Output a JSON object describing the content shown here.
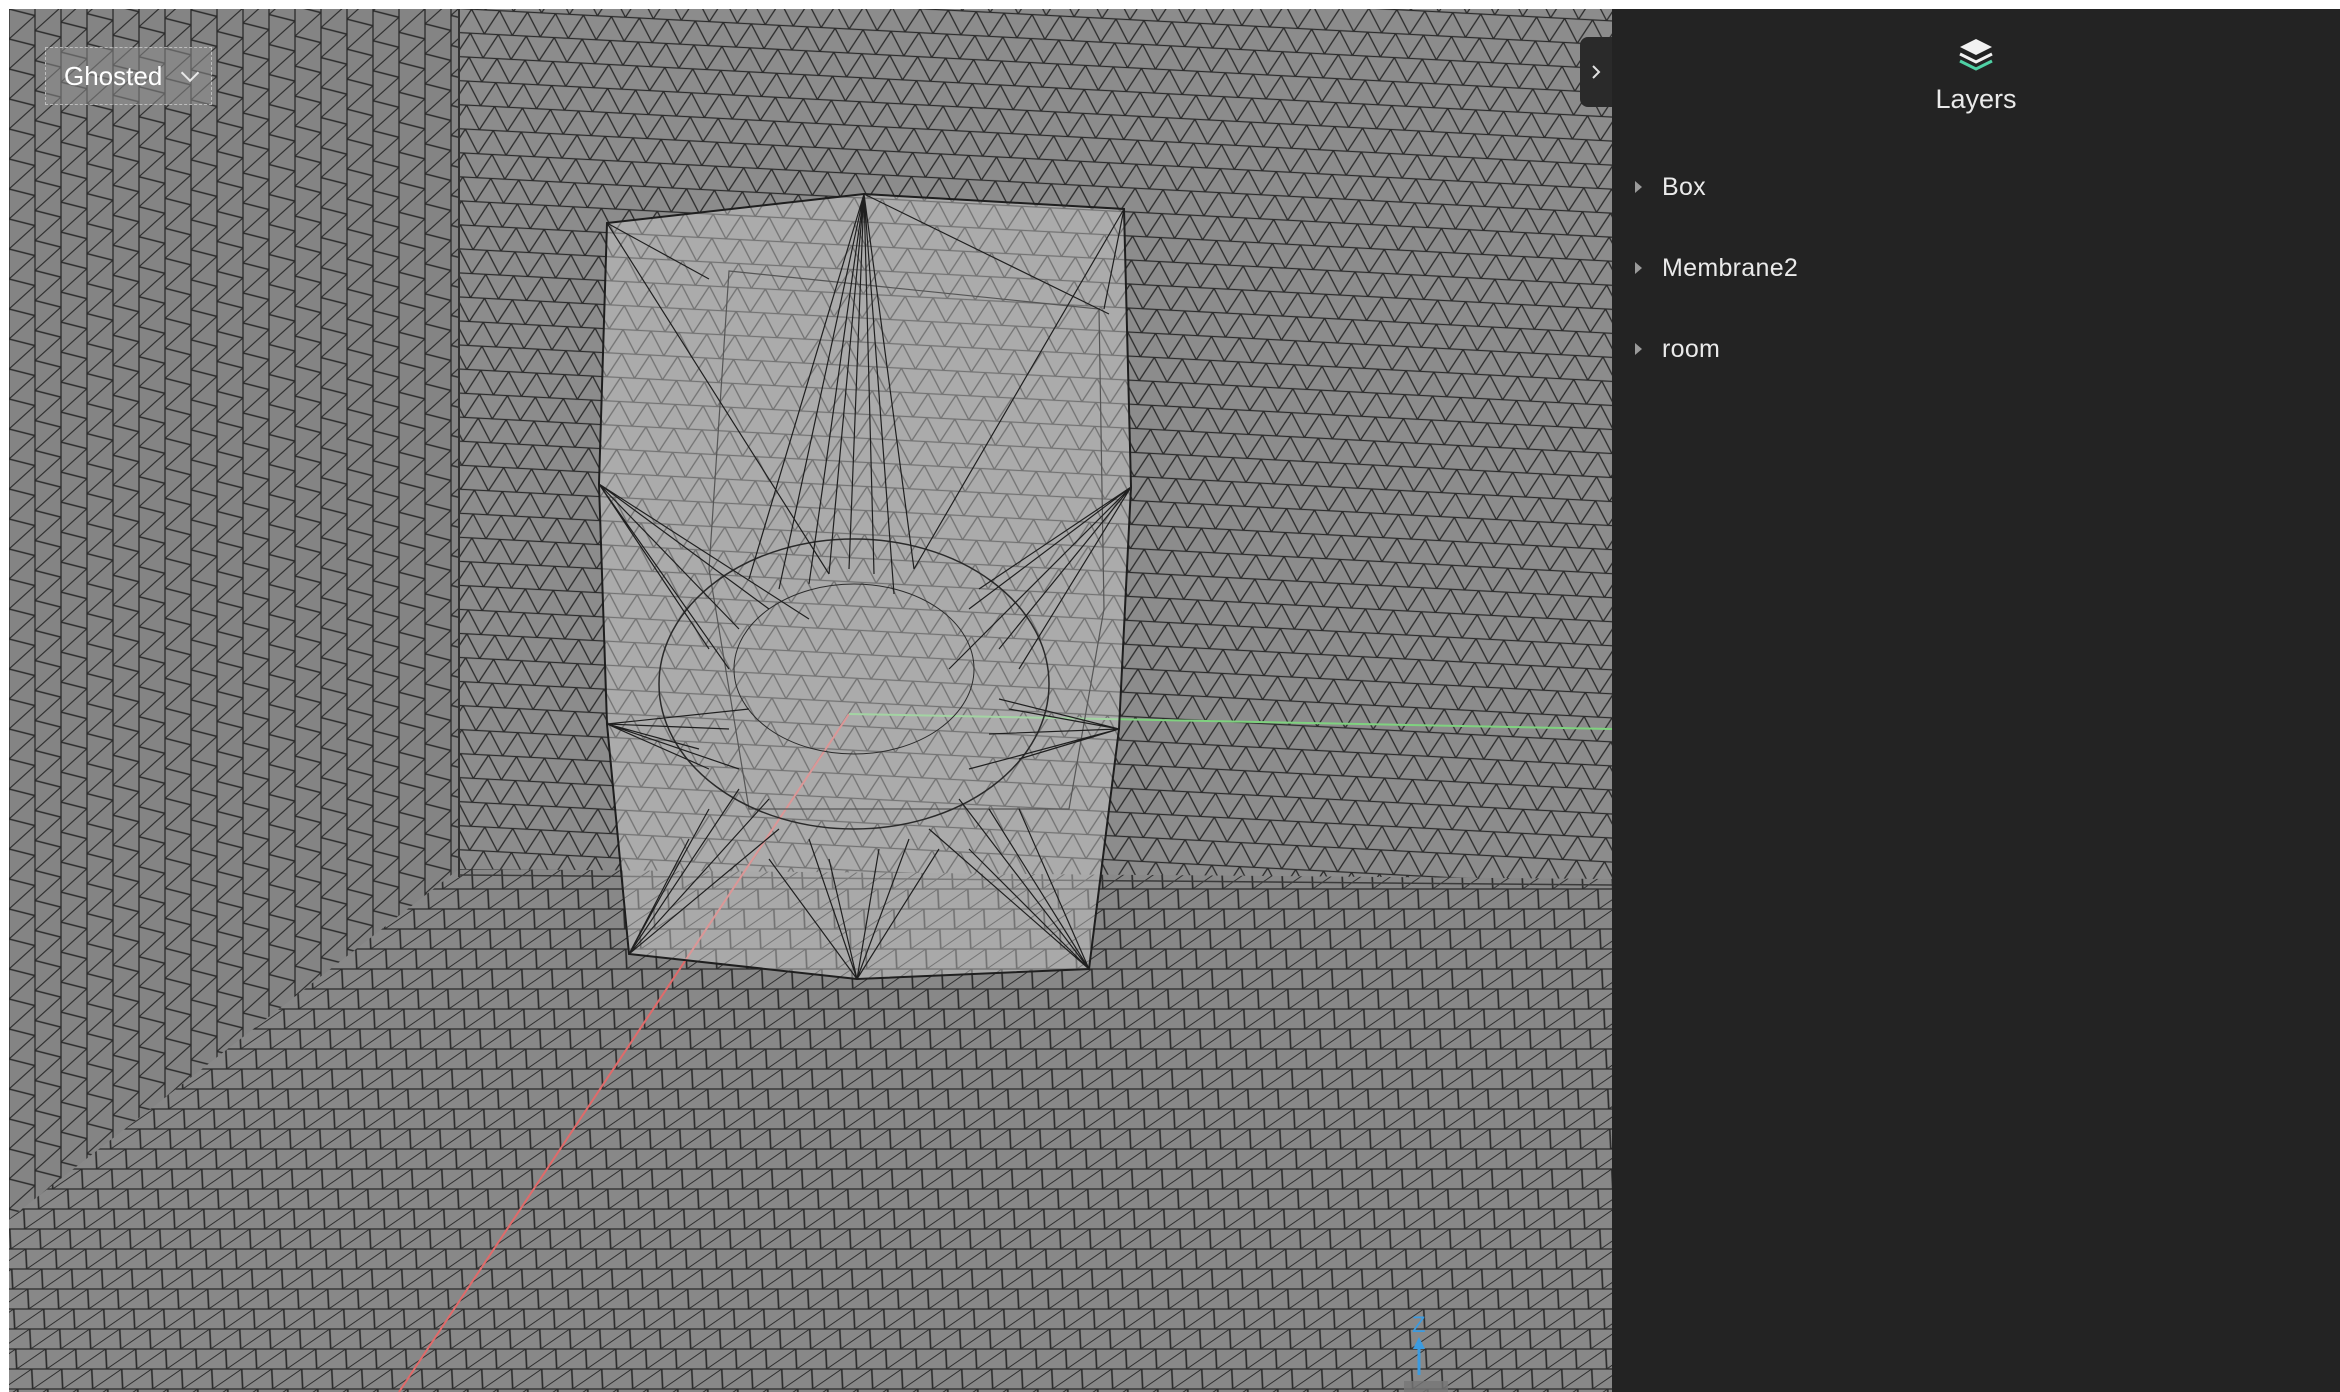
{
  "viewport": {
    "display_mode": "Ghosted",
    "axis_gizmo_label": "Z",
    "colors": {
      "background": "#8a8a8a",
      "mesh_lines": "#2b2b2b",
      "x_axis": "#e06a6a",
      "y_axis": "#7fd27f",
      "z_axis": "#3b9be0"
    }
  },
  "panel": {
    "icon": "layers-icon",
    "title": "Layers",
    "toggle_icon": "chevron-right-icon",
    "layers": [
      {
        "label": "Box"
      },
      {
        "label": "Membrane2"
      },
      {
        "label": "room"
      }
    ],
    "colors": {
      "background": "#232323",
      "accent": "#4fd1a5"
    }
  }
}
